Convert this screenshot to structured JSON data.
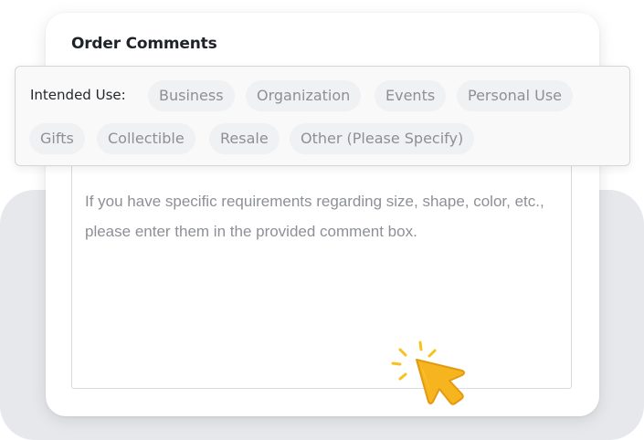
{
  "order_comments": {
    "title": "Order Comments",
    "comment_placeholder_line1": "If you have specific requirements regarding size, shape, color, etc.,",
    "comment_placeholder_line2": "please enter them in the provided comment box."
  },
  "intended_use": {
    "label": "Intended Use:",
    "options": [
      "Business",
      "Organization",
      "Events",
      "Personal Use",
      "Gifts",
      "Collectible",
      "Resale",
      "Other (Please Specify)"
    ]
  },
  "colors": {
    "background_panel": "#e6e8ec",
    "chip_background": "#f0f1f3",
    "cursor_accent": "#f6b51e"
  },
  "icons": {
    "cursor": "pointer-cursor-icon"
  }
}
